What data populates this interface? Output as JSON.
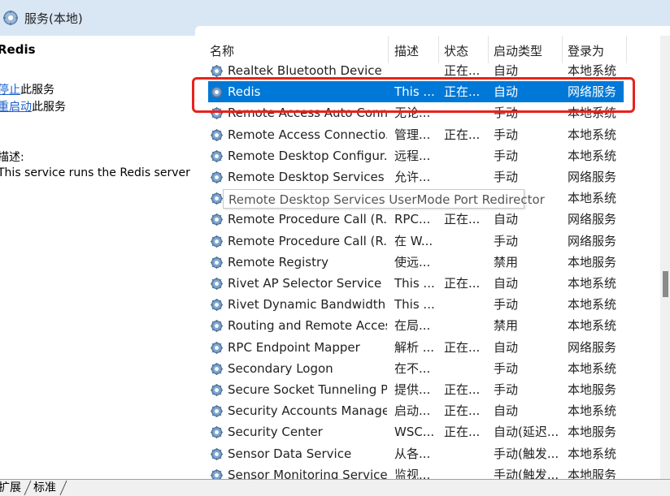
{
  "window": {
    "title": "服务(本地)"
  },
  "left_pane": {
    "service_name": "Redis",
    "actions": [
      {
        "link": "停止",
        "suffix": "此服务"
      },
      {
        "link": "重启动",
        "suffix": "此服务"
      }
    ],
    "description_label": "描述:",
    "description_text": "This service runs the Redis server"
  },
  "columns": [
    "名称",
    "描述",
    "状态",
    "启动类型",
    "登录为"
  ],
  "rows": [
    {
      "name": "Realtek Bluetooth Device ...",
      "desc": "",
      "status": "正在...",
      "startup": "自动",
      "logon": "本地系统"
    },
    {
      "name": "Redis",
      "desc": "This ...",
      "status": "正在...",
      "startup": "自动",
      "logon": "网络服务"
    },
    {
      "name": "Remote Access Auto Conn...",
      "desc": "无论...",
      "status": "",
      "startup": "手动",
      "logon": "本地系统"
    },
    {
      "name": "Remote Access Connectio...",
      "desc": "管理...",
      "status": "正在...",
      "startup": "手动",
      "logon": "本地系统"
    },
    {
      "name": "Remote Desktop Configur...",
      "desc": "远程...",
      "status": "",
      "startup": "手动",
      "logon": "本地系统"
    },
    {
      "name": "Remote Desktop Services",
      "desc": "允许...",
      "status": "",
      "startup": "手动",
      "logon": "网络服务"
    },
    {
      "name": "",
      "desc": "",
      "status": "",
      "startup": "手动",
      "logon": "本地系统"
    },
    {
      "name": "Remote Procedure Call (R...",
      "desc": "RPC...",
      "status": "正在...",
      "startup": "自动",
      "logon": "网络服务"
    },
    {
      "name": "Remote Procedure Call (R...",
      "desc": "在 W...",
      "status": "",
      "startup": "手动",
      "logon": "网络服务"
    },
    {
      "name": "Remote Registry",
      "desc": "使远...",
      "status": "",
      "startup": "禁用",
      "logon": "本地服务"
    },
    {
      "name": "Rivet AP Selector Service",
      "desc": "This ...",
      "status": "正在...",
      "startup": "自动",
      "logon": "本地系统"
    },
    {
      "name": "Rivet Dynamic Bandwidth ...",
      "desc": "This ...",
      "status": "",
      "startup": "手动",
      "logon": "本地系统"
    },
    {
      "name": "Routing and Remote Access",
      "desc": "在局...",
      "status": "",
      "startup": "禁用",
      "logon": "本地系统"
    },
    {
      "name": "RPC Endpoint Mapper",
      "desc": "解析 ...",
      "status": "正在...",
      "startup": "自动",
      "logon": "网络服务"
    },
    {
      "name": "Secondary Logon",
      "desc": "在不...",
      "status": "",
      "startup": "手动",
      "logon": "本地系统"
    },
    {
      "name": "Secure Socket Tunneling P...",
      "desc": "提供...",
      "status": "正在...",
      "startup": "手动",
      "logon": "本地服务"
    },
    {
      "name": "Security Accounts Manager",
      "desc": "启动...",
      "status": "正在...",
      "startup": "自动",
      "logon": "本地系统"
    },
    {
      "name": "Security Center",
      "desc": "WSC...",
      "status": "正在...",
      "startup": "自动(延迟...",
      "logon": "本地服务"
    },
    {
      "name": "Sensor Data Service",
      "desc": "从各...",
      "status": "",
      "startup": "手动(触发...",
      "logon": "本地系统"
    },
    {
      "name": "Sensor Monitoring Service",
      "desc": "监视...",
      "status": "",
      "startup": "手动(触发...",
      "logon": "本地服务"
    }
  ],
  "selected_row": 1,
  "tooltip": "Remote Desktop Services UserMode Port Redirector",
  "bottom_tabs": [
    "扩展",
    "标准"
  ],
  "colors": {
    "selection": "#0078d7",
    "highlight": "#e8221c",
    "link": "#1a5fcc"
  }
}
